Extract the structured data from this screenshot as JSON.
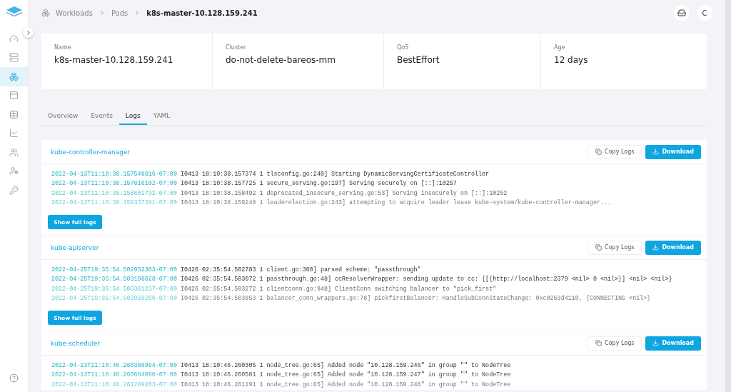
{
  "breadcrumbs": [
    {
      "label": "Workloads",
      "current": false
    },
    {
      "label": "Pods",
      "current": false
    },
    {
      "label": "k8s-master-10.128.159.241",
      "current": true
    }
  ],
  "sidebar": {
    "items": [
      {
        "kind": "gauge",
        "selected": false
      },
      {
        "kind": "server",
        "selected": false
      },
      {
        "kind": "boxes",
        "selected": true
      },
      {
        "kind": "panel",
        "selected": false
      },
      {
        "kind": "table",
        "selected": false
      },
      {
        "kind": "chart",
        "selected": false
      },
      {
        "kind": "users",
        "selected": false
      },
      {
        "kind": "user-key",
        "selected": false
      },
      {
        "kind": "key",
        "selected": false
      }
    ]
  },
  "user": {
    "initial": "C"
  },
  "summary": [
    {
      "label": "Name",
      "value": "k8s-master-10.128.159.241"
    },
    {
      "label": "Cluster",
      "value": "do-not-delete-bareos-mm"
    },
    {
      "label": "QoS",
      "value": "BestEffort"
    },
    {
      "label": "Age",
      "value": "12 days"
    }
  ],
  "tabs": [
    {
      "label": "Overview",
      "selected": false
    },
    {
      "label": "Events",
      "selected": false
    },
    {
      "label": "Logs",
      "selected": true
    },
    {
      "label": "YAML",
      "selected": false
    }
  ],
  "containers": [
    {
      "name": "kube-controller-manager",
      "copy_label": "Copy Logs",
      "download_label": "Download",
      "show_label": "Show full logs",
      "lines": [
        {
          "time": "2022-04-13T11:10:38.157548816-07:00",
          "message": "I0413 18:10:38.157374 1 tlsconfig.go:240] Starting DynamicServingCertificateController"
        },
        {
          "time": "2022-04-13T11:10:38.157816102-07:00",
          "message": "I0413 18:10:38.157725 1 secure_serving.go:197] Serving securely on [::]:10257"
        },
        {
          "time": "2022-04-13T11:10:38.158602732-07:00",
          "message": "I0413 18:10:38.158492 1 deprecated_insecure_serving.go:53] Serving insecurely on [::]:10252"
        },
        {
          "time": "2022-04-13T11:10:38.159337391-07:00",
          "message": "I0413 18:10:38.159248 1 leaderelection.go:243] attempting to acquire leader lease kube-system/kube-controller-manager..."
        }
      ]
    },
    {
      "name": "kube-apiserver",
      "copy_label": "Copy Logs",
      "download_label": "Download",
      "show_label": "Show full logs",
      "lines": [
        {
          "time": "2022-04-25T19:35:54.502952303-07:00",
          "message": "I0426 02:35:54.502783 1 client.go:360] parsed scheme: \"passthrough\""
        },
        {
          "time": "2022-04-25T19:35:54.503196628-07:00",
          "message": "I0426 02:35:54.503072 1 passthrough.go:48] ccResolverWrapper: sending update to cc: {[{http://localhost:2379 <nil> 0 <nil>}] <nil> <nil>}"
        },
        {
          "time": "2022-04-25T19:35:54.503361237-07:00",
          "message": "I0426 02:35:54.503272 1 clientconn.go:948] ClientConn switching balancer to \"pick_first\""
        },
        {
          "time": "2022-04-25T19:35:54.503959266-07:00",
          "message": "I0426 02:35:54.503853 1 balancer_conn_wrappers.go:78] pickfirstBalancer: HandleSubConnStateChange: 0xc0263d4110, {CONNECTING <nil>}"
        }
      ]
    },
    {
      "name": "kube-scheduler",
      "copy_label": "Copy Logs",
      "download_label": "Download",
      "lines": [
        {
          "time": "2022-04-13T11:10:46.260386994-07:00",
          "message": "I0413 18:10:46.260305 1 node_tree.go:65] Added node \"10.128.159.246\" in group \"\" to NodeTree"
        },
        {
          "time": "2022-04-13T11:10:46.260684090-07:00",
          "message": "I0413 18:10:46.260581 1 node_tree.go:65] Added node \"10.128.159.247\" in group \"\" to NodeTree"
        },
        {
          "time": "2022-04-13T11:10:46.261289283-07:00",
          "message": "I0413 18:10:46.261191 1 node_tree.go:65] Added node \"10.128.159.248\" in group \"\" to NodeTree"
        }
      ]
    }
  ]
}
